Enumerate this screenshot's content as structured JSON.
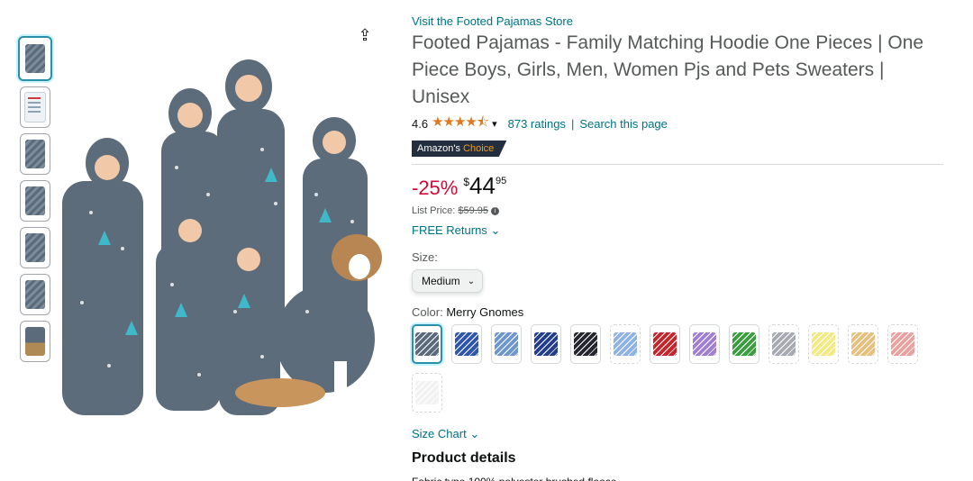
{
  "thumbnails": [
    {
      "kind": "pj",
      "selected": true
    },
    {
      "kind": "doc",
      "selected": false
    },
    {
      "kind": "pj",
      "selected": false
    },
    {
      "kind": "pj",
      "selected": false
    },
    {
      "kind": "pj",
      "selected": false
    },
    {
      "kind": "pj",
      "selected": false
    },
    {
      "kind": "dog",
      "selected": false
    }
  ],
  "product": {
    "store_link": "Visit the Footed Pajamas Store",
    "title": "Footed Pajamas - Family Matching Hoodie One Pieces | One Piece Boys, Girls, Men, Women Pjs and Pets Sweaters | Unisex",
    "rating": "4.6",
    "stars": "★★★★⯪",
    "ratings_count": "873 ratings",
    "separator": "|",
    "search_page": "Search this page",
    "badge_prefix": "Amazon's",
    "badge_choice": "Choice"
  },
  "price": {
    "discount": "-25%",
    "symbol": "$",
    "whole": "44",
    "fraction": "95",
    "list_label": "List Price:",
    "list_value": "$59.95",
    "info_icon": "i",
    "free_returns": "FREE Returns"
  },
  "size": {
    "label": "Size:",
    "selected": "Medium"
  },
  "color": {
    "label": "Color:",
    "selected": "Merry Gnomes",
    "swatches": [
      {
        "color": "#5b6b7b",
        "selected": true,
        "dashed": false
      },
      {
        "color": "#2f56a8",
        "selected": false,
        "dashed": false
      },
      {
        "color": "#6f97c9",
        "selected": false,
        "dashed": false
      },
      {
        "color": "#233f8a",
        "selected": false,
        "dashed": false
      },
      {
        "color": "#26262e",
        "selected": false,
        "dashed": false
      },
      {
        "color": "#8fb3e3",
        "selected": false,
        "dashed": true
      },
      {
        "color": "#c1272d",
        "selected": false,
        "dashed": false
      },
      {
        "color": "#a07fcf",
        "selected": false,
        "dashed": false
      },
      {
        "color": "#3f9c43",
        "selected": false,
        "dashed": false
      },
      {
        "color": "#a7aab0",
        "selected": false,
        "dashed": true
      },
      {
        "color": "#f3ea86",
        "selected": false,
        "dashed": true
      },
      {
        "color": "#e5c07e",
        "selected": false,
        "dashed": true
      },
      {
        "color": "#e9a2a2",
        "selected": false,
        "dashed": true
      },
      {
        "color": "#f2f2f2",
        "selected": false,
        "dashed": true
      }
    ]
  },
  "size_chart": "Size Chart",
  "product_details_heading": "Product details",
  "details_peek": "Fabric type   100% polyester brushed fleece",
  "icons": {
    "share": "share-icon",
    "chevron": "chevron-down-icon"
  }
}
